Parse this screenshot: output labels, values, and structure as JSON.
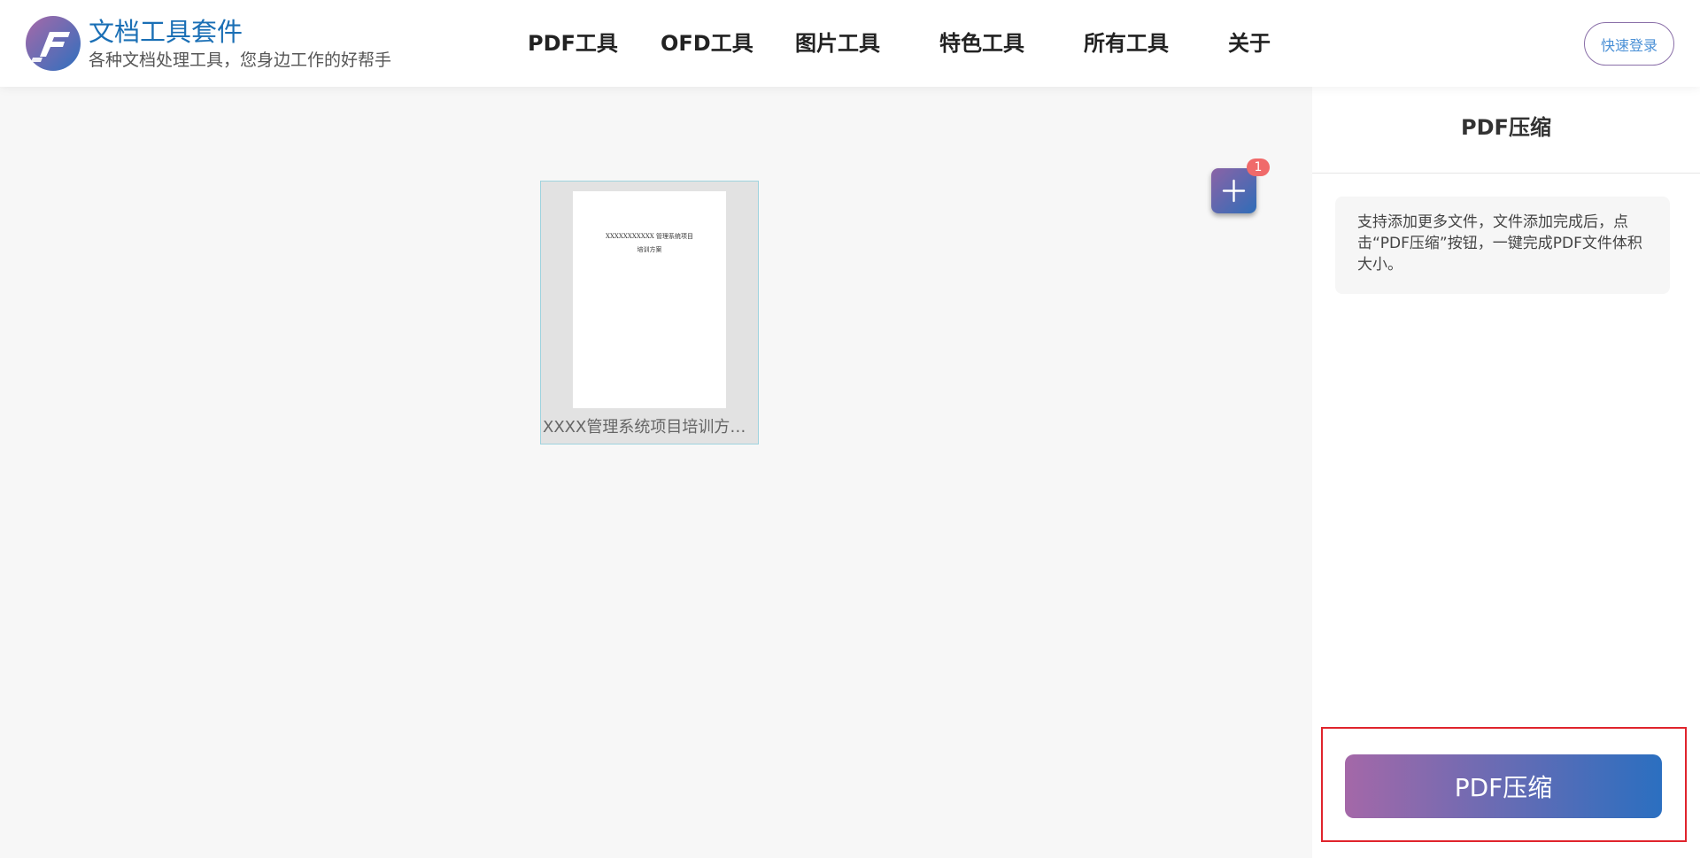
{
  "header": {
    "brand_title": "文档工具套件",
    "brand_subtitle": "各种文档处理工具，您身边工作的好帮手",
    "nav": [
      {
        "label": "PDF工具"
      },
      {
        "label": "OFD工具"
      },
      {
        "label": "图片工具"
      },
      {
        "label": "特色工具"
      },
      {
        "label": "所有工具"
      },
      {
        "label": "关于"
      }
    ],
    "login_label": "快速登录"
  },
  "main": {
    "file": {
      "name": "XXXX管理系统项目培训方案....",
      "thumb_line1": "XXXXXXXXXXX 管理系统项目",
      "thumb_line2": "培训方案"
    },
    "add_icon": "plus-icon",
    "badge_count": "1"
  },
  "panel": {
    "title": "PDF压缩",
    "info": "支持添加更多文件，文件添加完成后，点击“PDF压缩”按钮，一键完成PDF文件体积大小。",
    "action_label": "PDF压缩"
  },
  "colors": {
    "brand": "#1a6fb5",
    "accent_start": "#a468a8",
    "accent_end": "#2b6fc0",
    "badge": "#f06a6a",
    "highlight": "#e0242c"
  }
}
